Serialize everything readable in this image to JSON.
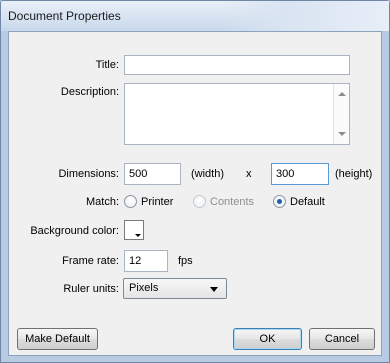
{
  "window": {
    "title": "Document Properties"
  },
  "form": {
    "title": {
      "label": "Title:",
      "value": ""
    },
    "description": {
      "label": "Description:",
      "value": ""
    },
    "dimensions": {
      "label": "Dimensions:",
      "width_value": "500",
      "width_unit": "(width)",
      "separator": "x",
      "height_value": "300",
      "height_unit": "(height)"
    },
    "match": {
      "label": "Match:",
      "options": [
        {
          "label": "Printer",
          "state": "unselected"
        },
        {
          "label": "Contents",
          "state": "disabled"
        },
        {
          "label": "Default",
          "state": "selected"
        }
      ]
    },
    "background_color": {
      "label": "Background color:",
      "color": "#ffffff"
    },
    "frame_rate": {
      "label": "Frame rate:",
      "value": "12",
      "unit": "fps"
    },
    "ruler_units": {
      "label": "Ruler units:",
      "selected": "Pixels"
    }
  },
  "buttons": {
    "make_default": "Make Default",
    "ok": "OK",
    "cancel": "Cancel"
  },
  "colors": {
    "titlebar": "#c9d9ec",
    "client": "#f0f0f0",
    "selected_radio": "#1d5fa8"
  }
}
